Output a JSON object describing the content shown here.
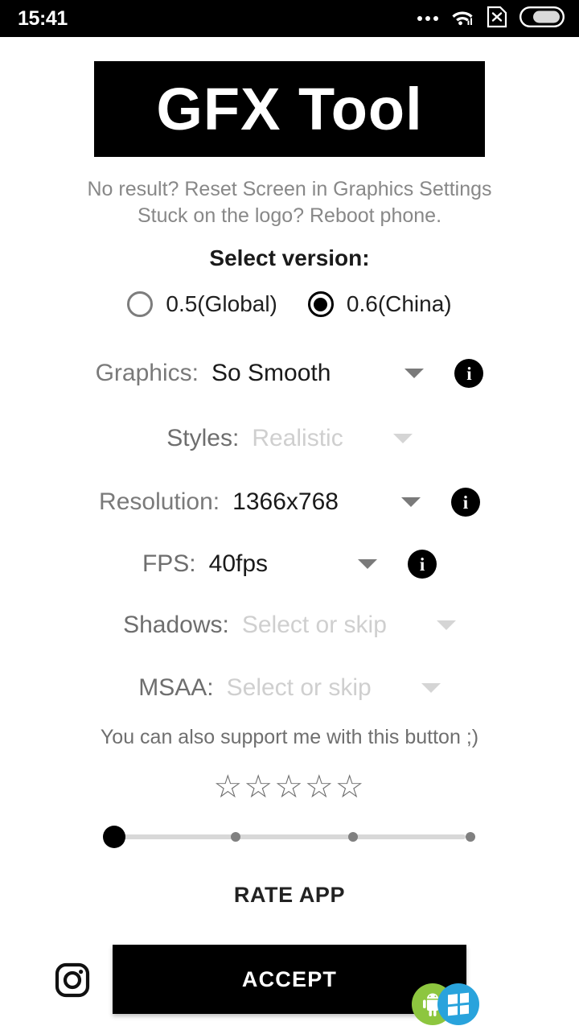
{
  "status_bar": {
    "clock": "15:41",
    "icons": [
      "more-dots-icon",
      "wifi-icon",
      "sim-no-service-icon",
      "battery-icon"
    ]
  },
  "app": {
    "logo_text": "GFX Tool"
  },
  "hints": {
    "line1": "No result? Reset Screen in Graphics Settings",
    "line2": "Stuck on the logo? Reboot phone."
  },
  "version": {
    "title": "Select version:",
    "options": [
      {
        "label": "0.5(Global)",
        "selected": false
      },
      {
        "label": "0.6(China)",
        "selected": true
      }
    ]
  },
  "settings": {
    "graphics": {
      "label": "Graphics:",
      "value": "So Smooth",
      "placeholder": false,
      "has_info": true
    },
    "styles": {
      "label": "Styles:",
      "value": "Realistic",
      "placeholder": true,
      "has_info": false
    },
    "resolution": {
      "label": "Resolution:",
      "value": "1366x768",
      "placeholder": false,
      "has_info": true
    },
    "fps": {
      "label": "FPS:",
      "value": "40fps",
      "placeholder": false,
      "has_info": true
    },
    "shadows": {
      "label": "Shadows:",
      "value": "Select or skip",
      "placeholder": true,
      "has_info": false
    },
    "msaa": {
      "label": "MSAA:",
      "value": "Select or skip",
      "placeholder": true,
      "has_info": false
    }
  },
  "support": {
    "text": "You can also support me with this button ;)",
    "stars": "☆☆☆☆☆",
    "star_count": 5
  },
  "slider": {
    "value": 0,
    "steps": 4,
    "tick_count": 3
  },
  "actions": {
    "rate_app": "RATE APP",
    "accept": "ACCEPT"
  },
  "footer_icons": {
    "instagram": "instagram-icon",
    "android": "android-icon",
    "windows": "windows-icon"
  },
  "colors": {
    "banner_bg": "#000000",
    "banner_text": "#ffffff",
    "accept_bg": "#000000",
    "muted_text": "#7a7a7a",
    "placeholder_text": "#cfcfcf",
    "android_green": "#8dc63f",
    "windows_blue": "#29a3dc"
  }
}
